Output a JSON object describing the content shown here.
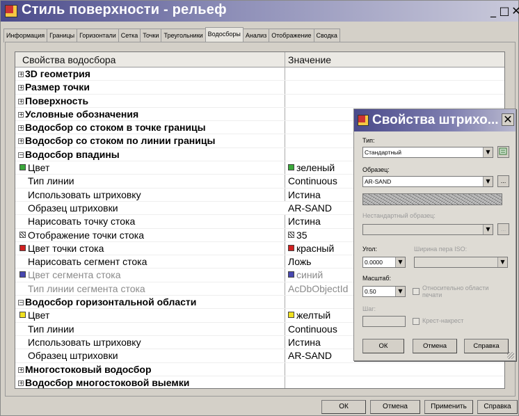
{
  "window": {
    "title": "Стиль поверхности - рельеф",
    "controls": {
      "minimize": "_",
      "maximize": "□",
      "close": "✕"
    }
  },
  "tabs": [
    "Информация",
    "Границы",
    "Горизонтали",
    "Сетка",
    "Точки",
    "Треугольники",
    "Водосборы",
    "Анализ",
    "Отображение",
    "Сводка"
  ],
  "active_tab": "Водосборы",
  "grid": {
    "headers": {
      "property": "Свойства водосбора",
      "value": "Значение"
    },
    "rows": [
      {
        "label": "3D геометрия",
        "value": ""
      },
      {
        "label": "Размер точки",
        "value": ""
      },
      {
        "label": "Поверхность",
        "value": ""
      },
      {
        "label": "Условные обозначения",
        "value": ""
      },
      {
        "label": "Водосбор со стоком в точке границы",
        "value": ""
      },
      {
        "label": "Водосбор со стоком по линии границы",
        "value": ""
      },
      {
        "label": "Водосбор впадины",
        "value": ""
      },
      {
        "label": "Цвет",
        "value": "зеленый"
      },
      {
        "label": "Тип линии",
        "value": "Continuous"
      },
      {
        "label": "Использовать штриховку",
        "value": "Истина"
      },
      {
        "label": "Образец штриховки",
        "value": "AR-SAND"
      },
      {
        "label": "Нарисовать точку стока",
        "value": "Истина"
      },
      {
        "label": "Отображение точки стока",
        "value": "35"
      },
      {
        "label": "Цвет точки стока",
        "value": "красный"
      },
      {
        "label": "Нарисовать сегмент стока",
        "value": "Ложь"
      },
      {
        "label": "Цвет сегмента стока",
        "value": "синий"
      },
      {
        "label": "Тип линии сегмента стока",
        "value": "AcDbObjectId"
      },
      {
        "label": "Водосбор горизонтальной области",
        "value": ""
      },
      {
        "label": "Цвет",
        "value": "желтый"
      },
      {
        "label": "Тип линии",
        "value": "Continuous"
      },
      {
        "label": "Использовать штриховку",
        "value": "Истина"
      },
      {
        "label": "Образец штриховки",
        "value": "AR-SAND"
      },
      {
        "label": "Многостоковый водосбор",
        "value": ""
      },
      {
        "label": "Водосбор многостоковой выемки",
        "value": ""
      }
    ],
    "expander_plus": "+",
    "expander_minus": "−"
  },
  "colors": {
    "green": "#3aa83a",
    "red": "#d02020",
    "blue": "#4848b0",
    "yellow": "#f0e020"
  },
  "bottom_buttons": {
    "ok": "ОК",
    "cancel": "Отмена",
    "apply": "Применить",
    "help": "Справка"
  },
  "hatch_dialog": {
    "title": "Свойства штрихо...",
    "close": "✕",
    "type_label": "Тип:",
    "type_value": "Стандартный",
    "pattern_label": "Образец:",
    "pattern_value": "AR-SAND",
    "custom_label": "Нестандартный образец:",
    "angle_label": "Угол:",
    "angle_value": "0.0000",
    "pen_width_label": "Ширина пера ISO:",
    "scale_label": "Масштаб:",
    "scale_value": "0.50",
    "relative_label": "Относительно области печати",
    "step_label": "Шаг:",
    "crosshatch_label": "Крест-накрест",
    "ok": "ОК",
    "cancel": "Отмена",
    "help": "Справка",
    "browse": "..."
  }
}
